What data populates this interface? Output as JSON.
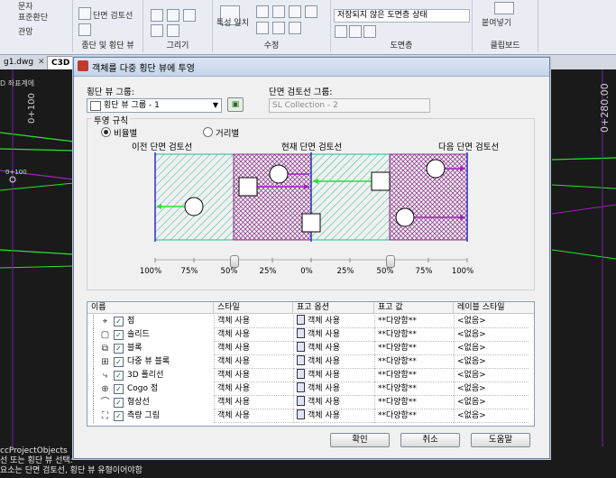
{
  "ribbon": {
    "left_items": [
      "문자",
      "표준환단",
      "관망"
    ],
    "mid_items": [
      "단면 검토선"
    ],
    "feature_line": "특성 일치",
    "layer_combo": "저장되지 않은 도면층 상태",
    "panels": {
      "section_views": "종단 및 횡단 뷰",
      "draw": "그리기",
      "modify": "수정",
      "layers": "도면층",
      "clipboard": "클립보드",
      "paste": "붙여넣기"
    }
  },
  "doc_tabs": [
    "g1.dwg",
    "C3D"
  ],
  "canvas": {
    "label_left": "0+100",
    "label_right": "0+280.00",
    "small_label": "0+100",
    "top_text": "D 좌표계에"
  },
  "command_line": [
    "ccProjectObjects",
    "선 또는 횡단 뷰 선택:",
    "요소는 단면 검토선, 횡단 뷰 유형이어야함"
  ],
  "dialog": {
    "title": "객체를 다중 횡단 뷰에 투영",
    "group_label": "횡단 뷰 그룹:",
    "group_value": "횡단 뷰 그룹 - 1",
    "sample_label": "단면 검토선 그룹:",
    "sample_value": "SL Collection - 2",
    "projection_rules": "투영 규칙",
    "radio_proportional": "비율별",
    "radio_distance": "거리별",
    "prev_label": "이전 단면 검토선",
    "current_label": "현재 단면 검토선",
    "next_label": "다음 단면 검토선",
    "scale_labels": [
      "100%",
      "75%",
      "50%",
      "25%",
      "0%",
      "25%",
      "50%",
      "75%",
      "100%"
    ],
    "slider_left_pct": 50,
    "slider_right_pct": 50,
    "columns": [
      "이름",
      "스타일",
      "표고 옵션",
      "표고 값",
      "레이블 스타일"
    ],
    "rows": [
      {
        "icon": "point-icon",
        "glyph": "⌖",
        "name": "점",
        "style": "객체 사용",
        "elev": "객체 사용",
        "value": "**다양함**",
        "label": "<없음>"
      },
      {
        "icon": "solid-icon",
        "glyph": "▢",
        "name": "솔리드",
        "style": "객체 사용",
        "elev": "객체 사용",
        "value": "**다양함**",
        "label": "<없음>"
      },
      {
        "icon": "block-icon",
        "glyph": "⧉",
        "name": "블록",
        "style": "객체 사용",
        "elev": "객체 사용",
        "value": "**다양함**",
        "label": "<없음>"
      },
      {
        "icon": "multiview-block-icon",
        "glyph": "⊞",
        "name": "다중 뷰 블록",
        "style": "객체 사용",
        "elev": "객체 사용",
        "value": "**다양함**",
        "label": "<없음>"
      },
      {
        "icon": "3d-polyline-icon",
        "glyph": "⤷",
        "name": "3D 폴리선",
        "style": "객체 사용",
        "elev": "객체 사용",
        "value": "**다양함**",
        "label": "<없음>"
      },
      {
        "icon": "cogo-point-icon",
        "glyph": "⊕",
        "name": "Cogo 점",
        "style": "객체 사용",
        "elev": "객체 사용",
        "value": "**다양함**",
        "label": "<없음>"
      },
      {
        "icon": "feature-line-icon",
        "glyph": "⌒",
        "name": "형상선",
        "style": "객체 사용",
        "elev": "객체 사용",
        "value": "**다양함**",
        "label": "<없음>"
      },
      {
        "icon": "survey-figure-icon",
        "glyph": "⛶",
        "name": "측량 그림",
        "style": "객체 사용",
        "elev": "객체 사용",
        "value": "**다양함**",
        "label": "<없음>"
      }
    ],
    "ok": "확인",
    "cancel": "취소",
    "help": "도움말"
  },
  "colors": {
    "hatch_green": "#1fbf8f",
    "hatch_purple": "#8a2a8a",
    "green_line": "#2ee02e",
    "purple_line": "#a020c0",
    "blue_line": "#2a2ad0"
  }
}
